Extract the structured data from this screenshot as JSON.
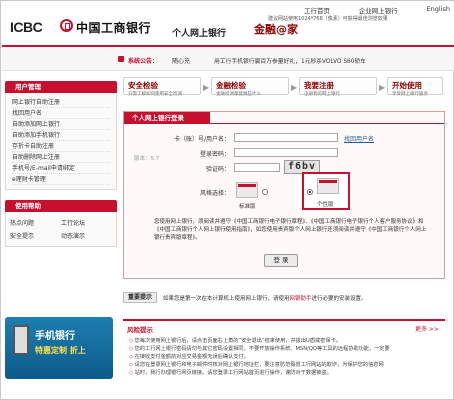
{
  "header": {
    "logo_en": "ICBC",
    "logo_cn": "中国工商银行",
    "site_title": "个人网上银行",
    "brand": "金融@家",
    "top_links": [
      "工行首页",
      "企业网上银行",
      "English"
    ],
    "notice": "建议网站使用1024*768（像素）可获得最佳浏览效果"
  },
  "announcement": {
    "label": "系统公告：",
    "user": "随心充",
    "text": "用工行手机银行赢百万参量好礼，1元秒杀VOLVO S60轿车"
  },
  "sidebar": {
    "head": "用户管理",
    "items": [
      "网上银行自助注册",
      "找回用户名",
      "自助添加网上银行",
      "自助添加手机银行",
      "存折卡自助注册",
      "自助删除网上注册",
      "手机号/E-mail申请绑定",
      "e理财卡管理"
    ],
    "help_head": "使用帮助",
    "help_links": [
      "热点问题",
      "工行论坛",
      "安全提示",
      "动态演示"
    ],
    "promo_title": "手机银行",
    "promo_sub": "特惠定制 折上"
  },
  "steps": [
    {
      "title": "安全检验",
      "sub": "只需了解如何使用安全检测"
    },
    {
      "title": "金融检验",
      "sub": "金融检测都能做些什么"
    },
    {
      "title": "我要注册",
      "sub": "注册我的网上银行"
    },
    {
      "title": "开始使用",
      "sub": "享受网上银行服务"
    }
  ],
  "login": {
    "tab": "个人网上银行登录",
    "version": "版本：5.7",
    "card_label": "卡（账）号/用户名：",
    "card_link": "找回用户名",
    "password_label": "登录密码：",
    "captcha_label": "验证码：",
    "captcha_value": "f6bv",
    "style_label": "风格选择：",
    "style_standard": "标准版",
    "style_personal": "个性版",
    "agree_text": "您使用网上银行，须阅读并遵守《中国工商银行电子银行章程》、《中国工商银行电子银行个人客户服务协议》和《中国工商银行个人网上银行使用指南》，如您使用贵宾版个人网上银行还须阅读并遵守《中国工商银行个人网上银行贵宾版章程》。",
    "button": "登 录"
  },
  "tip": {
    "tag": "重要提示",
    "text": "如果您是第一次在本计算机上使用网上银行，请使用",
    "link": "网银助手",
    "text2": "进行必要的安装设置。"
  },
  "risk": {
    "title": "风险提示",
    "more": "更多 >>",
    "items": [
      "您每次使用网上银行后，请点击页面右上角的“安全退出”结束使用，并拔出U盾或密保卡。",
      "您的工行网上银行密码请勿与其它密码设置相同，不要开放操作系统、MSN/QQ等工具的远程协助功能，一定要",
      "在接收支付金额前对应交易金额无误后确认支付。",
      "请您在登录网上银行和电子邮件时核对网上银行地址栏，要注意防范假冒工行网站的欺诈，为保护您的信息网",
      "站时，我行办理银行网页链接。请您登录工行网站首页进行操作，谨防对于数据被盗。"
    ]
  }
}
